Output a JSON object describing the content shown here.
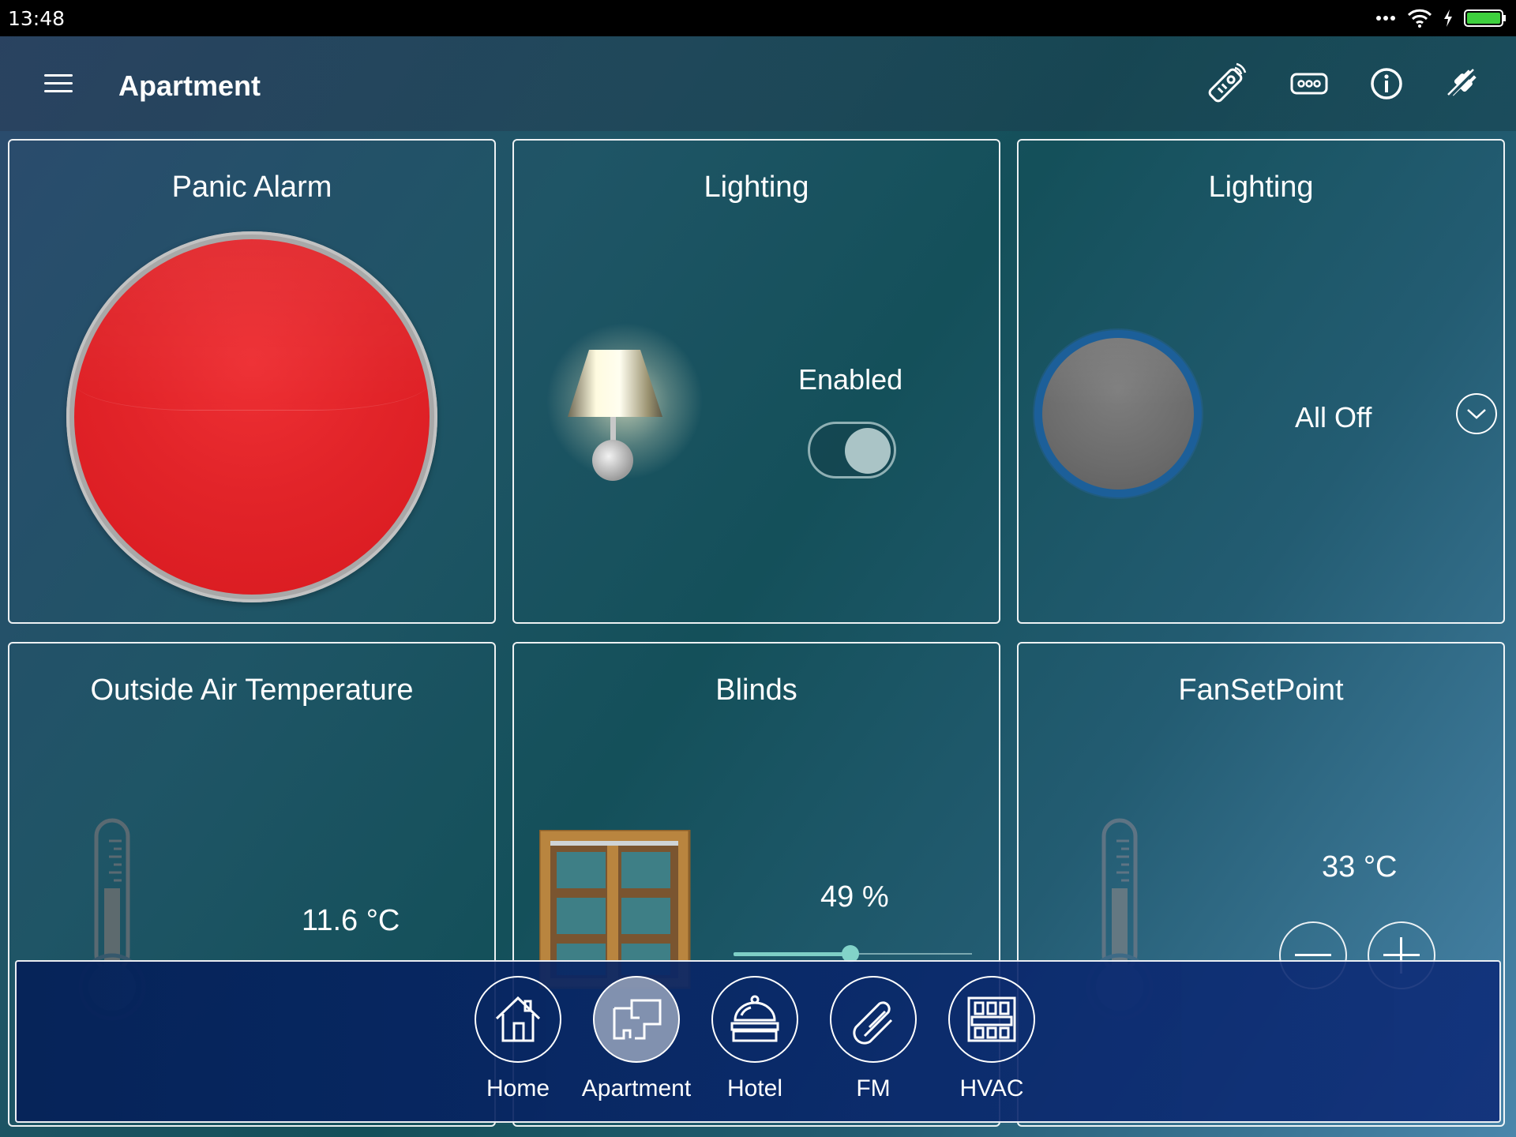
{
  "status_bar": {
    "time": "13:48"
  },
  "app_bar": {
    "title": "Apartment",
    "actions": [
      "remote-icon",
      "keypad-icon",
      "info-icon",
      "disconnect-plug-icon"
    ]
  },
  "tiles": {
    "panic_alarm": {
      "title": "Panic Alarm",
      "color": "#e0222a"
    },
    "lighting_switch": {
      "title": "Lighting",
      "status": "Enabled",
      "enabled": true
    },
    "lighting_scene": {
      "title": "Lighting",
      "value": "All Off"
    },
    "outside_temp": {
      "title": "Outside Air Temperature",
      "value": "11.6 °C"
    },
    "blinds": {
      "title": "Blinds",
      "value": "49 %",
      "level": 0.49
    },
    "fan_setpoint": {
      "title": "FanSetPoint",
      "value": "33 °C"
    }
  },
  "bottom_nav": {
    "items": [
      {
        "label": "Home",
        "icon": "home-icon",
        "active": false
      },
      {
        "label": "Apartment",
        "icon": "apartment-icon",
        "active": true
      },
      {
        "label": "Hotel",
        "icon": "hotel-bell-icon",
        "active": false
      },
      {
        "label": "FM",
        "icon": "paperclip-icon",
        "active": false
      },
      {
        "label": "HVAC",
        "icon": "hvac-icon",
        "active": false
      }
    ]
  },
  "colors": {
    "accent_slider": "#7ecfc6",
    "panic_red": "#e0222a",
    "nav_bg": "#0a2a6e"
  }
}
